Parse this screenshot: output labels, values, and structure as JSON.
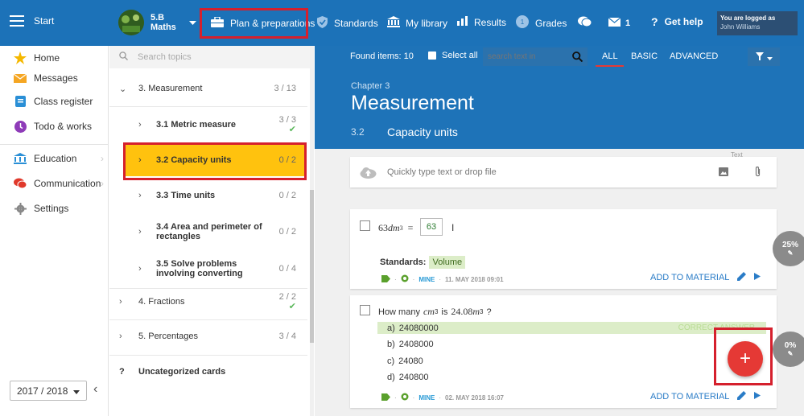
{
  "topbar": {
    "menu_label": "Start",
    "class_name": "5.B",
    "subject": "Maths",
    "plan_label": "Plan & preparations",
    "standards_label": "Standards",
    "library_label": "My library",
    "results_label": "Results",
    "grades_label": "Grades",
    "message_count": "1",
    "help_label": "Get help",
    "logged_label": "You are logged as",
    "user_name": "John Williams"
  },
  "sidebar": {
    "items": [
      {
        "label": "Home",
        "icon": "star-icon"
      },
      {
        "label": "Messages",
        "icon": "envelope-icon"
      },
      {
        "label": "Class register",
        "icon": "register-icon"
      },
      {
        "label": "Todo & works",
        "icon": "clock-icon"
      },
      {
        "label": "Education",
        "icon": "education-icon"
      },
      {
        "label": "Communication",
        "icon": "chat-icon"
      },
      {
        "label": "Settings",
        "icon": "gear-icon"
      }
    ],
    "year": "2017 / 2018"
  },
  "topics": {
    "search_placeholder": "Search topics",
    "items": [
      {
        "label": "3. Measurement",
        "count": "3 / 13"
      },
      {
        "label": "3.1 Metric measure",
        "count": "3 / 3"
      },
      {
        "label": "3.2 Capacity units",
        "count": "0 / 2"
      },
      {
        "label": "3.3 Time units",
        "count": "0 / 2"
      },
      {
        "label": "3.4 Area and perimeter of rectangles",
        "count": "0 / 2"
      },
      {
        "label": "3.5 Solve problems involving converting",
        "count": "0 / 4"
      },
      {
        "label": "4. Fractions",
        "count": "2 / 2"
      },
      {
        "label": "5. Percentages",
        "count": "3 / 4"
      },
      {
        "label": "Uncategorized cards",
        "count": ""
      }
    ]
  },
  "toolbar": {
    "found": "Found items: 10",
    "select_all": "Select all",
    "search_placeholder": "search text in",
    "filters": [
      "ALL",
      "BASIC",
      "ADVANCED"
    ]
  },
  "header": {
    "chapter": "Chapter 3",
    "title": "Measurement",
    "section_number": "3.2",
    "section_title": "Capacity units"
  },
  "quick_input": {
    "placeholder": "Quickly type text or drop file",
    "hint": "Text"
  },
  "cards": [
    {
      "question_value": "63",
      "question_prefix": "63",
      "question_unit_main": "dm",
      "question_unit_exp": "3",
      "question_eq": "=",
      "question_cursor": "I",
      "standards_label": "Standards:",
      "standard_tag": "Volume",
      "meta_owner": "MINE",
      "meta_date": "11. MAY 2018 09:01",
      "add_label": "ADD TO MATERIAL"
    },
    {
      "question_start": "How many",
      "question_unit_main": "cm",
      "question_unit_exp": "3",
      "question_mid": "is",
      "question_value": "24.08",
      "question_unit2_main": "m",
      "question_unit2_exp": "3",
      "question_end": "?",
      "options": [
        {
          "letter": "a)",
          "text": "24080000"
        },
        {
          "letter": "b)",
          "text": "2408000"
        },
        {
          "letter": "c)",
          "text": "24080"
        },
        {
          "letter": "d)",
          "text": "240800"
        }
      ],
      "correct_label": "CORRECT ANSWER",
      "meta_owner": "MINE",
      "meta_date": "02. MAY 2018 16:07",
      "add_label": "ADD TO MATERIAL"
    }
  ],
  "side_buttons": [
    {
      "label": "25%"
    },
    {
      "label": "0%"
    }
  ],
  "fab_label": "+",
  "colors": {
    "topbar": "#1c72b8",
    "header": "#1e73b8",
    "selected_topic": "#ffc20e",
    "highlight_box": "#d5202d",
    "correct_answer": "#dcedc8",
    "fab": "#e53935"
  }
}
